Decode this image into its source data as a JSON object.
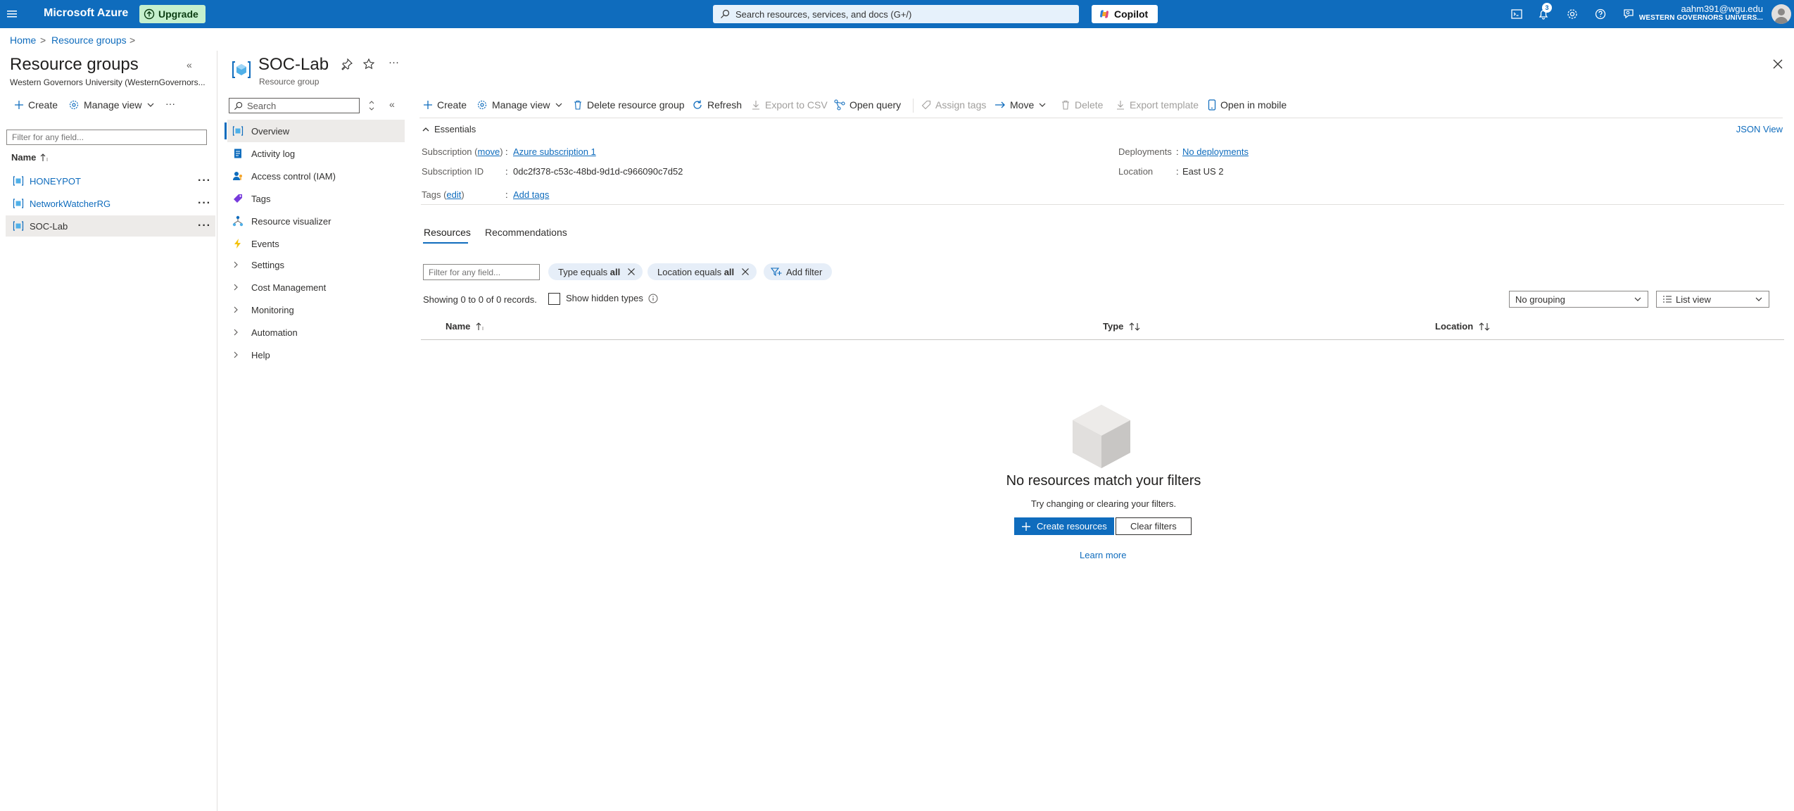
{
  "topbar": {
    "brand": "Microsoft Azure",
    "upgrade_label": "Upgrade",
    "search_placeholder": "Search resources, services, and docs (G+/)",
    "copilot_label": "Copilot",
    "notification_count": "3",
    "user_email": "aahm391@wgu.edu",
    "user_org": "WESTERN GOVERNORS UNIVERS...",
    "icons": [
      "menu-icon",
      "upgrade-icon",
      "search-icon",
      "copilot-icon",
      "cloud-shell-icon",
      "notifications-icon",
      "settings-icon",
      "help-icon",
      "feedback-icon",
      "avatar"
    ],
    "bar_color": "#0f6cbd"
  },
  "breadcrumb": {
    "items": [
      "Home",
      "Resource groups"
    ],
    "separator": ">"
  },
  "left_pane": {
    "title": "Resource groups",
    "subtitle": "Western Governors University (WesternGovernors...",
    "collapse_glyph": "«",
    "toolbar": {
      "create": "Create",
      "manage_view": "Manage view",
      "more": "···"
    },
    "filter_placeholder": "Filter for any field...",
    "column_name": "Name",
    "groups": [
      "HONEYPOT",
      "NetworkWatcherRG",
      "SOC-Lab"
    ],
    "selected": "SOC-Lab"
  },
  "resource": {
    "name": "SOC-Lab",
    "type": "Resource group",
    "more": "···"
  },
  "resource_menu": {
    "search_placeholder": "Search",
    "collapse_glyph": "«",
    "items": [
      {
        "label": "Overview",
        "icon": "overview-icon"
      },
      {
        "label": "Activity log",
        "icon": "activity-log-icon"
      },
      {
        "label": "Access control (IAM)",
        "icon": "iam-icon"
      },
      {
        "label": "Tags",
        "icon": "tags-icon"
      },
      {
        "label": "Resource visualizer",
        "icon": "resource-visualizer-icon"
      },
      {
        "label": "Events",
        "icon": "events-icon"
      }
    ],
    "groups": [
      "Settings",
      "Cost Management",
      "Monitoring",
      "Automation",
      "Help"
    ],
    "selected": "Overview"
  },
  "command_bar": {
    "create": "Create",
    "manage_view": "Manage view",
    "delete_rg": "Delete resource group",
    "refresh": "Refresh",
    "export_csv": "Export to CSV",
    "open_query": "Open query",
    "assign_tags": "Assign tags",
    "move": "Move",
    "delete": "Delete",
    "export_template": "Export template",
    "open_mobile": "Open in mobile"
  },
  "essentials": {
    "title": "Essentials",
    "json_view": "JSON View",
    "subscription_label": "Subscription",
    "subscription_move": "move",
    "subscription_value": "Azure subscription 1",
    "subscription_id_label": "Subscription ID",
    "subscription_id_value": "0dc2f378-c53c-48bd-9d1d-c966090c7d52",
    "tags_label": "Tags",
    "tags_edit": "edit",
    "tags_value": "Add tags",
    "deployments_label": "Deployments",
    "deployments_value": "No deployments",
    "location_label": "Location",
    "location_value": "East US 2",
    "colon": ":"
  },
  "tabs": {
    "resources": "Resources",
    "recommendations": "Recommendations",
    "active": "Resources"
  },
  "filters": {
    "filter_placeholder": "Filter for any field...",
    "type_prefix": "Type equals",
    "type_value": "all",
    "location_prefix": "Location equals",
    "location_value": "all",
    "add_filter": "Add filter",
    "records_text": "Showing 0 to 0 of 0 records.",
    "show_hidden": "Show hidden types",
    "show_hidden_checked": false,
    "grouping": "No grouping",
    "view": "List view"
  },
  "table": {
    "columns": [
      "Name",
      "Type",
      "Location"
    ],
    "rows": []
  },
  "empty_state": {
    "title": "No resources match your filters",
    "subtitle": "Try changing or clearing your filters.",
    "create_button": "Create resources",
    "clear_button": "Clear filters",
    "learn_more": "Learn more"
  }
}
